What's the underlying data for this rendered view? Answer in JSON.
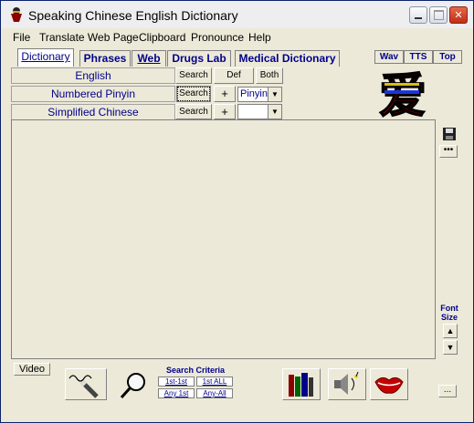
{
  "window": {
    "title": "Speaking Chinese English Dictionary",
    "controls": [
      "minimize",
      "maximize",
      "close"
    ]
  },
  "menu": [
    "File",
    "Translate Web Page",
    "Clipboard",
    "Pronounce",
    "Help"
  ],
  "tabs": [
    {
      "label": "Dictionary",
      "active": true
    },
    {
      "label": "Phrases",
      "active": false
    },
    {
      "label": "Web",
      "active": false
    },
    {
      "label": "Drugs Lab",
      "active": false
    },
    {
      "label": "Medical Dictionary",
      "active": false
    }
  ],
  "small_tabs": [
    "Wav",
    "TTS",
    "Top"
  ],
  "search_rows": [
    {
      "field": "English",
      "button": "Search",
      "extra_a": "Def",
      "extra_b": "Both"
    },
    {
      "field": "Numbered Pinyin",
      "button": "Search",
      "plus": "+",
      "combo": "Pinyin"
    },
    {
      "field": "Simplified Chinese",
      "button": "Search",
      "plus": "+",
      "combo": ""
    }
  ],
  "logo_char": "爱",
  "right_panel": {
    "font_size_label": "Font Size"
  },
  "bottom": {
    "video_label": "Video",
    "search_criteria_title": "Search Criteria",
    "criteria_buttons": [
      "1st-1st",
      "1st ALL",
      "Any 1st",
      "Any-All"
    ],
    "ellipsis": "..."
  },
  "colors": {
    "accent": "#00008b",
    "window_bg": "#ece9d8"
  }
}
